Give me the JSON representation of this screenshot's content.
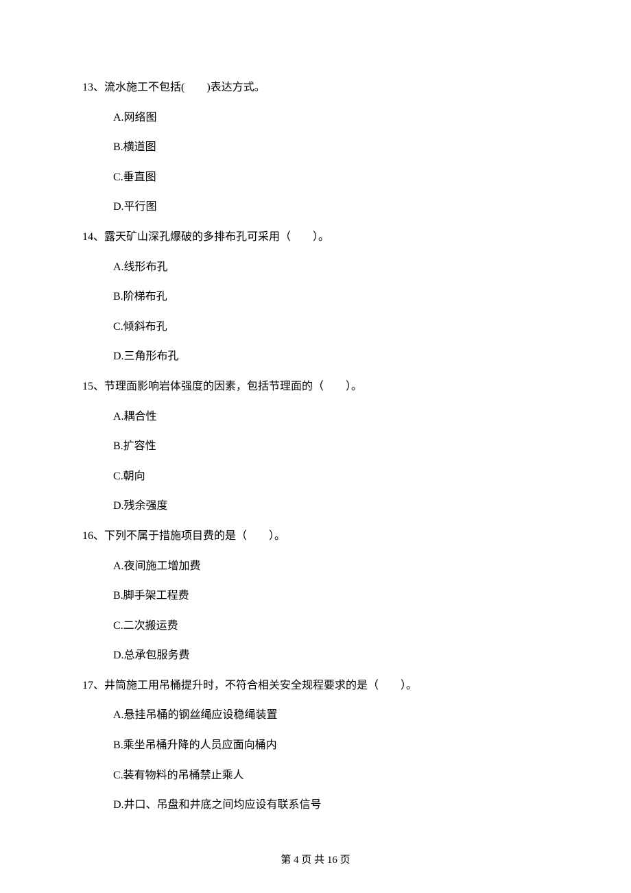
{
  "questions": [
    {
      "number": "13、",
      "text": "流水施工不包括(　　)表达方式。",
      "options": {
        "a": "A.网络图",
        "b": "B.横道图",
        "c": "C.垂直图",
        "d": "D.平行图"
      }
    },
    {
      "number": "14、",
      "text": "露天矿山深孔爆破的多排布孔可采用（　　）。",
      "options": {
        "a": "A.线形布孔",
        "b": "B.阶梯布孔",
        "c": "C.倾斜布孔",
        "d": "D.三角形布孔"
      }
    },
    {
      "number": "15、",
      "text": "节理面影响岩体强度的因素，包括节理面的（　　）。",
      "options": {
        "a": "A.耦合性",
        "b": "B.扩容性",
        "c": "C.朝向",
        "d": "D.残余强度"
      }
    },
    {
      "number": "16、",
      "text": "下列不属于措施项目费的是（　　）。",
      "options": {
        "a": "A.夜间施工增加费",
        "b": "B.脚手架工程费",
        "c": "C.二次搬运费",
        "d": "D.总承包服务费"
      }
    },
    {
      "number": "17、",
      "text": "井筒施工用吊桶提升时，不符合相关安全规程要求的是（　　）。",
      "options": {
        "a": "A.悬挂吊桶的钢丝绳应设稳绳装置",
        "b": "B.乘坐吊桶升降的人员应面向桶内",
        "c": "C.装有物料的吊桶禁止乘人",
        "d": "D.井口、吊盘和井底之间均应设有联系信号"
      }
    }
  ],
  "footer": "第 4 页 共 16 页"
}
